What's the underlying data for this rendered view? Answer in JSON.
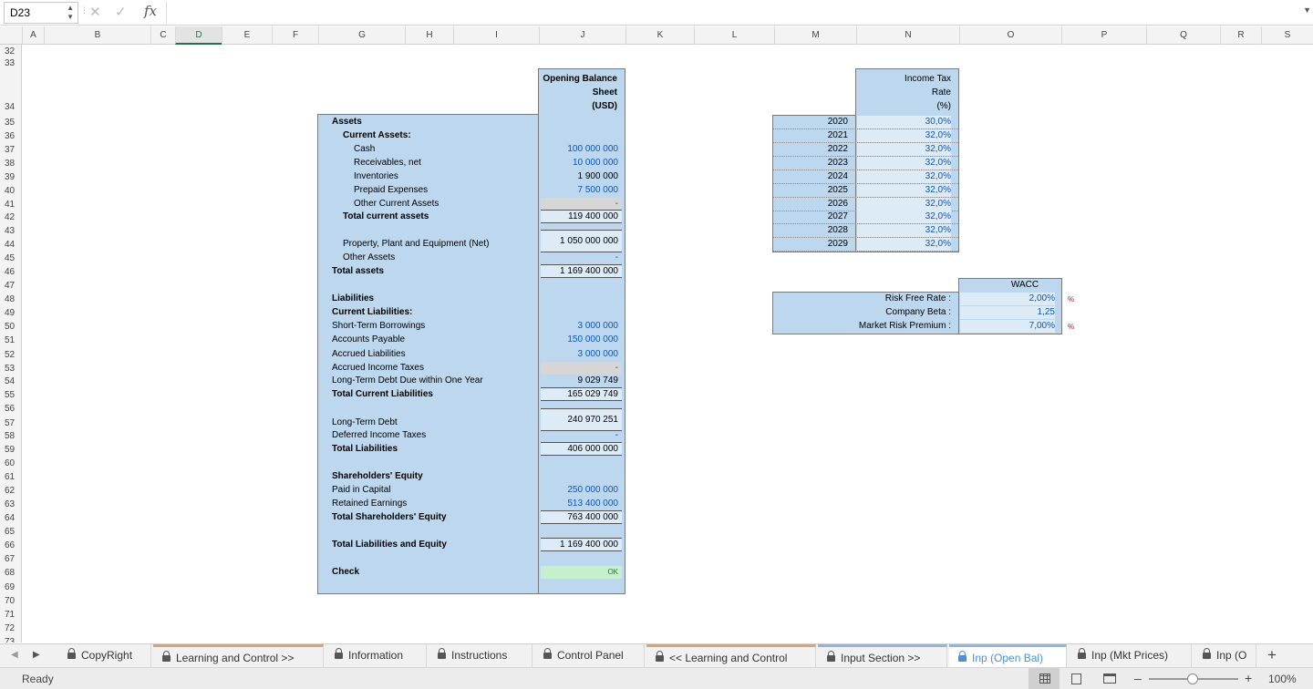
{
  "formula_bar": {
    "name_box": "D23",
    "fx": "fx",
    "formula": ""
  },
  "columns": [
    "A",
    "B",
    "C",
    "D",
    "E",
    "F",
    "G",
    "H",
    "I",
    "J",
    "K",
    "L",
    "M",
    "N",
    "O",
    "P",
    "Q",
    "R",
    "S"
  ],
  "rows": [
    "32",
    "33",
    "34",
    "35",
    "36",
    "37",
    "38",
    "39",
    "40",
    "41",
    "42",
    "43",
    "44",
    "45",
    "46",
    "47",
    "48",
    "49",
    "50",
    "51",
    "52",
    "53",
    "54",
    "55",
    "56",
    "57",
    "58",
    "59",
    "60",
    "61",
    "62",
    "63",
    "64",
    "65",
    "66",
    "67",
    "68",
    "69",
    "70",
    "71",
    "72",
    "73"
  ],
  "balance_sheet": {
    "header": [
      "Opening Balance",
      "Sheet",
      "(USD)"
    ],
    "lines": [
      {
        "label": "Assets",
        "value": "",
        "style": "bold"
      },
      {
        "label": "Current Assets:",
        "value": "",
        "style": "bold"
      },
      {
        "label": "Cash",
        "value": "100 000 000",
        "style": "input"
      },
      {
        "label": "Receivables, net",
        "value": "10 000 000",
        "style": "input"
      },
      {
        "label": "Inventories",
        "value": "1 900 000",
        "style": "calc"
      },
      {
        "label": "Prepaid Expenses",
        "value": "7 500 000",
        "style": "input"
      },
      {
        "label": "Other Current Assets",
        "value": "-",
        "style": "grey"
      },
      {
        "label": "Total current assets",
        "value": "119 400 000",
        "style": "total"
      },
      {
        "label": "Property, Plant and Equipment (Net)",
        "value": "1 050 000 000",
        "style": "boxed"
      },
      {
        "label": "Other Assets",
        "value": "-",
        "style": "input"
      },
      {
        "label": "Total assets",
        "value": "1 169 400 000",
        "style": "total"
      },
      {
        "label": "Liabilities",
        "value": "",
        "style": "bold"
      },
      {
        "label": "Current Liabilities:",
        "value": "",
        "style": "bold"
      },
      {
        "label": "Short-Term Borrowings",
        "value": "3 000 000",
        "style": "input"
      },
      {
        "label": "Accounts Payable",
        "value": "150 000 000",
        "style": "input"
      },
      {
        "label": "Accrued Liabilities",
        "value": "3 000 000",
        "style": "input"
      },
      {
        "label": "Accrued Income Taxes",
        "value": "-",
        "style": "grey"
      },
      {
        "label": "Long-Term Debt Due within One Year",
        "value": "9 029 749",
        "style": "calc"
      },
      {
        "label": "Total Current Liabilities",
        "value": "165 029 749",
        "style": "total"
      },
      {
        "label": "Long-Term Debt",
        "value": "240 970 251",
        "style": "boxed"
      },
      {
        "label": "Deferred Income Taxes",
        "value": "-",
        "style": "input"
      },
      {
        "label": "Total Liabilities",
        "value": "406 000 000",
        "style": "total"
      },
      {
        "label": "Shareholders' Equity",
        "value": "",
        "style": "bold"
      },
      {
        "label": "Paid in Capital",
        "value": "250 000 000",
        "style": "input"
      },
      {
        "label": "Retained Earnings",
        "value": "513 400 000",
        "style": "input"
      },
      {
        "label": "Total Shareholders' Equity",
        "value": "763 400 000",
        "style": "total"
      },
      {
        "label": "Total Liabilities and Equity",
        "value": "1 169 400 000",
        "style": "total"
      },
      {
        "label": "Check",
        "value": "OK",
        "style": "check"
      }
    ]
  },
  "income_tax": {
    "header": [
      "Income Tax",
      "Rate",
      "(%)"
    ],
    "rows": [
      {
        "year": "2020",
        "rate": "30,0%"
      },
      {
        "year": "2021",
        "rate": "32,0%"
      },
      {
        "year": "2022",
        "rate": "32,0%"
      },
      {
        "year": "2023",
        "rate": "32,0%"
      },
      {
        "year": "2024",
        "rate": "32,0%"
      },
      {
        "year": "2025",
        "rate": "32,0%"
      },
      {
        "year": "2026",
        "rate": "32,0%"
      },
      {
        "year": "2027",
        "rate": "32,0%"
      },
      {
        "year": "2028",
        "rate": "32,0%"
      },
      {
        "year": "2029",
        "rate": "32,0%"
      }
    ]
  },
  "wacc": {
    "header": "WACC",
    "rows": [
      {
        "label": "Risk Free Rate :",
        "value": "2,00%",
        "note": "%"
      },
      {
        "label": "Company Beta :",
        "value": "1,25",
        "note": ""
      },
      {
        "label": "Market Risk Premium :",
        "value": "7,00%",
        "note": "%"
      }
    ]
  },
  "sheet_tabs": [
    {
      "label": "CopyRight",
      "active": false,
      "accent": ""
    },
    {
      "label": "Learning and Control >>",
      "active": false,
      "accent": "#e0a070"
    },
    {
      "label": "Information",
      "active": false,
      "accent": ""
    },
    {
      "label": "Instructions",
      "active": false,
      "accent": ""
    },
    {
      "label": "Control Panel",
      "active": false,
      "accent": ""
    },
    {
      "label": "<< Learning and Control",
      "active": false,
      "accent": "#e0a070"
    },
    {
      "label": "Input Section >>",
      "active": false,
      "accent": "#8fb4e0"
    },
    {
      "label": "Inp (Open Bal)",
      "active": true,
      "accent": "#8fb4e0"
    },
    {
      "label": "Inp (Mkt Prices)",
      "active": false,
      "accent": ""
    },
    {
      "label": "Inp (O",
      "active": false,
      "accent": ""
    }
  ],
  "status": {
    "text": "Ready",
    "zoom": "100%"
  },
  "colors": {
    "input_blue": "#0b56b8",
    "box_fill": "#bdd7ee",
    "ok_fill": "#c6efce",
    "active_tab": "#4a90d9"
  }
}
